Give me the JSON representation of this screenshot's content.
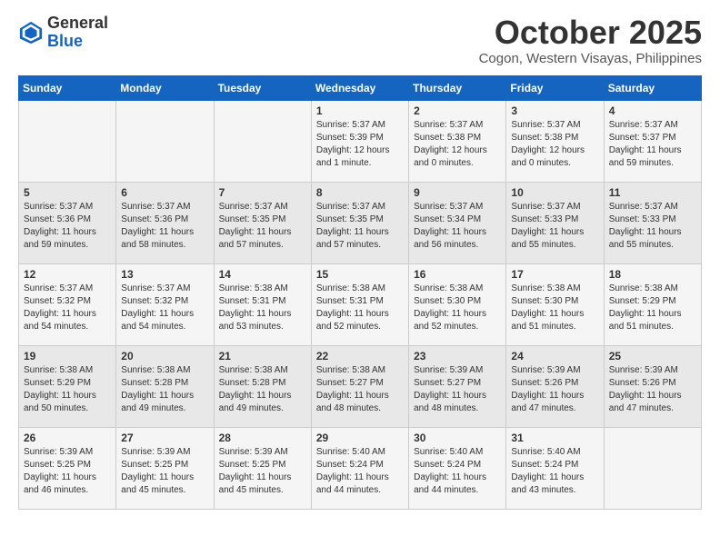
{
  "header": {
    "logo": {
      "general": "General",
      "blue": "Blue"
    },
    "month": "October 2025",
    "location": "Cogon, Western Visayas, Philippines"
  },
  "weekdays": [
    "Sunday",
    "Monday",
    "Tuesday",
    "Wednesday",
    "Thursday",
    "Friday",
    "Saturday"
  ],
  "weeks": [
    [
      {
        "day": "",
        "sunrise": "",
        "sunset": "",
        "daylight": ""
      },
      {
        "day": "",
        "sunrise": "",
        "sunset": "",
        "daylight": ""
      },
      {
        "day": "",
        "sunrise": "",
        "sunset": "",
        "daylight": ""
      },
      {
        "day": "1",
        "sunrise": "Sunrise: 5:37 AM",
        "sunset": "Sunset: 5:39 PM",
        "daylight": "Daylight: 12 hours and 1 minute."
      },
      {
        "day": "2",
        "sunrise": "Sunrise: 5:37 AM",
        "sunset": "Sunset: 5:38 PM",
        "daylight": "Daylight: 12 hours and 0 minutes."
      },
      {
        "day": "3",
        "sunrise": "Sunrise: 5:37 AM",
        "sunset": "Sunset: 5:38 PM",
        "daylight": "Daylight: 12 hours and 0 minutes."
      },
      {
        "day": "4",
        "sunrise": "Sunrise: 5:37 AM",
        "sunset": "Sunset: 5:37 PM",
        "daylight": "Daylight: 11 hours and 59 minutes."
      }
    ],
    [
      {
        "day": "5",
        "sunrise": "Sunrise: 5:37 AM",
        "sunset": "Sunset: 5:36 PM",
        "daylight": "Daylight: 11 hours and 59 minutes."
      },
      {
        "day": "6",
        "sunrise": "Sunrise: 5:37 AM",
        "sunset": "Sunset: 5:36 PM",
        "daylight": "Daylight: 11 hours and 58 minutes."
      },
      {
        "day": "7",
        "sunrise": "Sunrise: 5:37 AM",
        "sunset": "Sunset: 5:35 PM",
        "daylight": "Daylight: 11 hours and 57 minutes."
      },
      {
        "day": "8",
        "sunrise": "Sunrise: 5:37 AM",
        "sunset": "Sunset: 5:35 PM",
        "daylight": "Daylight: 11 hours and 57 minutes."
      },
      {
        "day": "9",
        "sunrise": "Sunrise: 5:37 AM",
        "sunset": "Sunset: 5:34 PM",
        "daylight": "Daylight: 11 hours and 56 minutes."
      },
      {
        "day": "10",
        "sunrise": "Sunrise: 5:37 AM",
        "sunset": "Sunset: 5:33 PM",
        "daylight": "Daylight: 11 hours and 55 minutes."
      },
      {
        "day": "11",
        "sunrise": "Sunrise: 5:37 AM",
        "sunset": "Sunset: 5:33 PM",
        "daylight": "Daylight: 11 hours and 55 minutes."
      }
    ],
    [
      {
        "day": "12",
        "sunrise": "Sunrise: 5:37 AM",
        "sunset": "Sunset: 5:32 PM",
        "daylight": "Daylight: 11 hours and 54 minutes."
      },
      {
        "day": "13",
        "sunrise": "Sunrise: 5:37 AM",
        "sunset": "Sunset: 5:32 PM",
        "daylight": "Daylight: 11 hours and 54 minutes."
      },
      {
        "day": "14",
        "sunrise": "Sunrise: 5:38 AM",
        "sunset": "Sunset: 5:31 PM",
        "daylight": "Daylight: 11 hours and 53 minutes."
      },
      {
        "day": "15",
        "sunrise": "Sunrise: 5:38 AM",
        "sunset": "Sunset: 5:31 PM",
        "daylight": "Daylight: 11 hours and 52 minutes."
      },
      {
        "day": "16",
        "sunrise": "Sunrise: 5:38 AM",
        "sunset": "Sunset: 5:30 PM",
        "daylight": "Daylight: 11 hours and 52 minutes."
      },
      {
        "day": "17",
        "sunrise": "Sunrise: 5:38 AM",
        "sunset": "Sunset: 5:30 PM",
        "daylight": "Daylight: 11 hours and 51 minutes."
      },
      {
        "day": "18",
        "sunrise": "Sunrise: 5:38 AM",
        "sunset": "Sunset: 5:29 PM",
        "daylight": "Daylight: 11 hours and 51 minutes."
      }
    ],
    [
      {
        "day": "19",
        "sunrise": "Sunrise: 5:38 AM",
        "sunset": "Sunset: 5:29 PM",
        "daylight": "Daylight: 11 hours and 50 minutes."
      },
      {
        "day": "20",
        "sunrise": "Sunrise: 5:38 AM",
        "sunset": "Sunset: 5:28 PM",
        "daylight": "Daylight: 11 hours and 49 minutes."
      },
      {
        "day": "21",
        "sunrise": "Sunrise: 5:38 AM",
        "sunset": "Sunset: 5:28 PM",
        "daylight": "Daylight: 11 hours and 49 minutes."
      },
      {
        "day": "22",
        "sunrise": "Sunrise: 5:38 AM",
        "sunset": "Sunset: 5:27 PM",
        "daylight": "Daylight: 11 hours and 48 minutes."
      },
      {
        "day": "23",
        "sunrise": "Sunrise: 5:39 AM",
        "sunset": "Sunset: 5:27 PM",
        "daylight": "Daylight: 11 hours and 48 minutes."
      },
      {
        "day": "24",
        "sunrise": "Sunrise: 5:39 AM",
        "sunset": "Sunset: 5:26 PM",
        "daylight": "Daylight: 11 hours and 47 minutes."
      },
      {
        "day": "25",
        "sunrise": "Sunrise: 5:39 AM",
        "sunset": "Sunset: 5:26 PM",
        "daylight": "Daylight: 11 hours and 47 minutes."
      }
    ],
    [
      {
        "day": "26",
        "sunrise": "Sunrise: 5:39 AM",
        "sunset": "Sunset: 5:25 PM",
        "daylight": "Daylight: 11 hours and 46 minutes."
      },
      {
        "day": "27",
        "sunrise": "Sunrise: 5:39 AM",
        "sunset": "Sunset: 5:25 PM",
        "daylight": "Daylight: 11 hours and 45 minutes."
      },
      {
        "day": "28",
        "sunrise": "Sunrise: 5:39 AM",
        "sunset": "Sunset: 5:25 PM",
        "daylight": "Daylight: 11 hours and 45 minutes."
      },
      {
        "day": "29",
        "sunrise": "Sunrise: 5:40 AM",
        "sunset": "Sunset: 5:24 PM",
        "daylight": "Daylight: 11 hours and 44 minutes."
      },
      {
        "day": "30",
        "sunrise": "Sunrise: 5:40 AM",
        "sunset": "Sunset: 5:24 PM",
        "daylight": "Daylight: 11 hours and 44 minutes."
      },
      {
        "day": "31",
        "sunrise": "Sunrise: 5:40 AM",
        "sunset": "Sunset: 5:24 PM",
        "daylight": "Daylight: 11 hours and 43 minutes."
      },
      {
        "day": "",
        "sunrise": "",
        "sunset": "",
        "daylight": ""
      }
    ]
  ]
}
